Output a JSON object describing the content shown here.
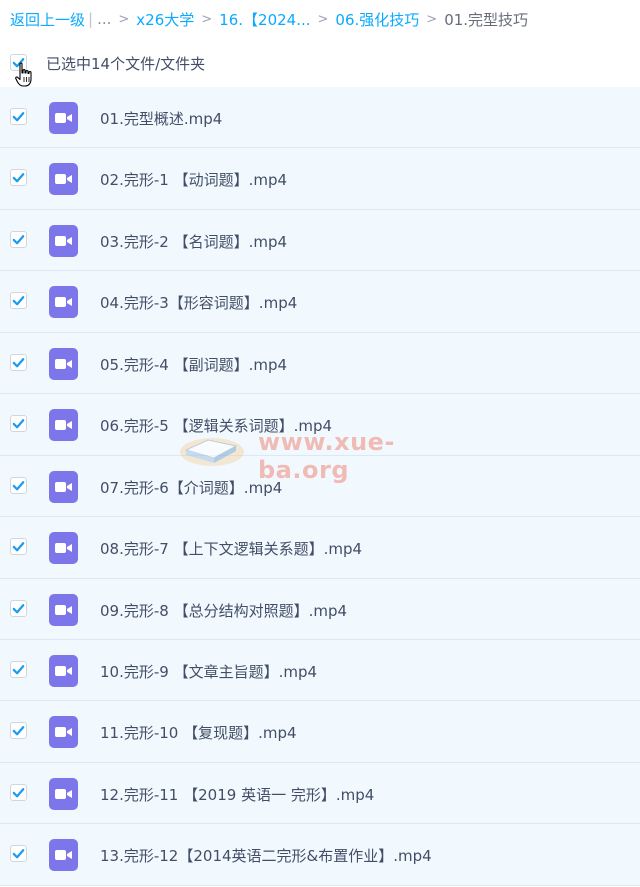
{
  "breadcrumb": {
    "back": "返回上一级",
    "separator": "|",
    "ellipsis": "...",
    "items": [
      "x26大学",
      "16.【2024...",
      "06.强化技巧"
    ],
    "current": "01.完型技巧"
  },
  "selection": {
    "label": "已选中14个文件/文件夹",
    "checked": true
  },
  "files": [
    {
      "name": "01.完型概述.mp4",
      "checked": true,
      "icon": "video-file-icon"
    },
    {
      "name": "02.完形-1 【动词题】.mp4",
      "checked": true,
      "icon": "video-file-icon"
    },
    {
      "name": "03.完形-2 【名词题】.mp4",
      "checked": true,
      "icon": "video-file-icon"
    },
    {
      "name": "04.完形-3【形容词题】.mp4",
      "checked": true,
      "icon": "video-file-icon"
    },
    {
      "name": "05.完形-4 【副词题】.mp4",
      "checked": true,
      "icon": "video-file-icon"
    },
    {
      "name": "06.完形-5 【逻辑关系词题】.mp4",
      "checked": true,
      "icon": "video-file-icon"
    },
    {
      "name": "07.完形-6【介词题】.mp4",
      "checked": true,
      "icon": "video-file-icon"
    },
    {
      "name": "08.完形-7 【上下文逻辑关系题】.mp4",
      "checked": true,
      "icon": "video-file-icon"
    },
    {
      "name": "09.完形-8 【总分结构对照题】.mp4",
      "checked": true,
      "icon": "video-file-icon"
    },
    {
      "name": "10.完形-9 【文章主旨题】.mp4",
      "checked": true,
      "icon": "video-file-icon"
    },
    {
      "name": "11.完形-10 【复现题】.mp4",
      "checked": true,
      "icon": "video-file-icon"
    },
    {
      "name": "12.完形-11 【2019 英语一 完形】.mp4",
      "checked": true,
      "icon": "video-file-icon"
    },
    {
      "name": "13.完形-12【2014英语二完形&布置作业】.mp4",
      "checked": true,
      "icon": "video-file-icon"
    }
  ],
  "watermark": {
    "text": "www.xue-ba.org"
  },
  "colors": {
    "accent": "#09aaff",
    "checkbox_check": "#1a9cf0",
    "row_background": "#f2f9fe",
    "video_icon": "#7d76ea",
    "watermark": "#f08a7a"
  }
}
